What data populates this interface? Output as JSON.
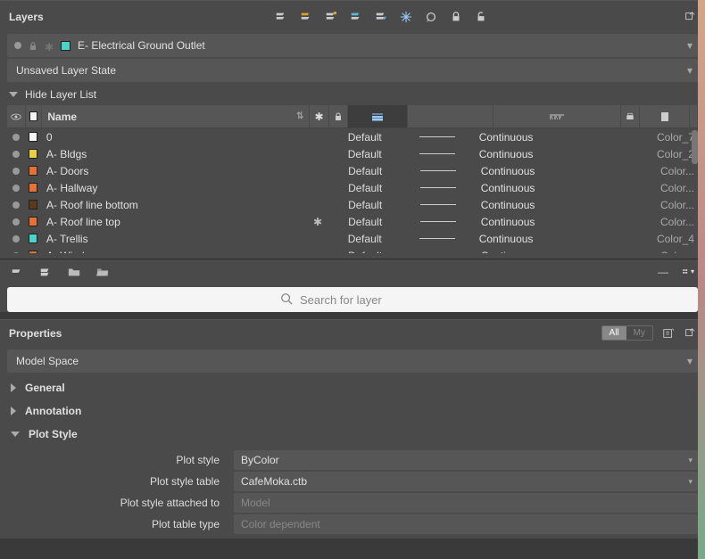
{
  "layers_panel": {
    "title": "Layers",
    "current_layer": {
      "name": "E- Electrical Ground Outlet",
      "color": "#4dd2c8"
    },
    "state": "Unsaved Layer State",
    "hide_label": "Hide Layer List",
    "columns": {
      "name": "Name"
    },
    "rows": [
      {
        "color": "#f5f5f5",
        "name": "0",
        "frozen": false,
        "lw": "Default",
        "ltype": "Continuous",
        "pstyle": "Color_7"
      },
      {
        "color": "#e8d040",
        "name": "A- Bldgs",
        "frozen": false,
        "lw": "Default",
        "ltype": "Continuous",
        "pstyle": "Color_2"
      },
      {
        "color": "#e87030",
        "name": "A- Doors",
        "frozen": false,
        "lw": "Default",
        "ltype": "Continuous",
        "pstyle": "Color..."
      },
      {
        "color": "#e87030",
        "name": "A- Hallway",
        "frozen": false,
        "lw": "Default",
        "ltype": "Continuous",
        "pstyle": "Color..."
      },
      {
        "color": "#5a3a1a",
        "name": "A- Roof line bottom",
        "frozen": false,
        "lw": "Default",
        "ltype": "Continuous",
        "pstyle": "Color..."
      },
      {
        "color": "#e87030",
        "name": "A- Roof line top",
        "frozen": true,
        "lw": "Default",
        "ltype": "Continuous",
        "pstyle": "Color..."
      },
      {
        "color": "#4dd2c8",
        "name": "A- Trellis",
        "frozen": false,
        "lw": "Default",
        "ltype": "Continuous",
        "pstyle": "Color_4"
      },
      {
        "color": "#e87030",
        "name": "A- Windows",
        "frozen": false,
        "lw": "Default",
        "ltype": "Continuous",
        "pstyle": "Color..."
      }
    ],
    "search_placeholder": "Search for layer"
  },
  "props_panel": {
    "title": "Properties",
    "tabs": {
      "all": "All",
      "my": "My"
    },
    "object": "Model Space",
    "sections": {
      "general": "General",
      "annotation": "Annotation",
      "plotstyle": "Plot Style"
    },
    "plotstyle_props": {
      "plot_style_label": "Plot style",
      "plot_style_value": "ByColor",
      "table_label": "Plot style table",
      "table_value": "CafeMoka.ctb",
      "attached_label": "Plot style attached to",
      "attached_value": "Model",
      "type_label": "Plot table type",
      "type_value": "Color dependent"
    }
  }
}
